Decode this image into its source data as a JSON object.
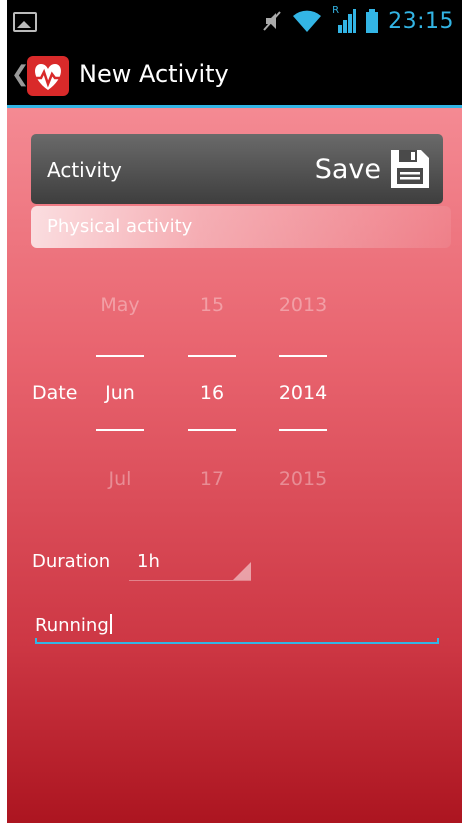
{
  "status_bar": {
    "time": "23:15",
    "icons": [
      "gallery-icon",
      "mute-icon",
      "wifi-icon",
      "signal-roaming-icon",
      "battery-icon"
    ],
    "roaming_indicator": "R"
  },
  "action_bar": {
    "title": "New Activity",
    "app_icon": "heart-pulse-icon",
    "accent_color": "#33b5e5"
  },
  "header": {
    "label": "Activity",
    "save_label": "Save",
    "save_icon": "floppy-disk-icon"
  },
  "category": "Physical activity",
  "date_picker": {
    "label": "Date",
    "month": {
      "prev": "May",
      "current": "Jun",
      "next": "Jul"
    },
    "day": {
      "prev": "15",
      "current": "16",
      "next": "17"
    },
    "year": {
      "prev": "2013",
      "current": "2014",
      "next": "2015"
    }
  },
  "duration": {
    "label": "Duration",
    "value": "1h"
  },
  "activity_name": {
    "value": "Running"
  },
  "colors": {
    "gradient_top": "#f48a93",
    "gradient_bottom": "#ac1520",
    "header_box": "#4a4a4a"
  }
}
